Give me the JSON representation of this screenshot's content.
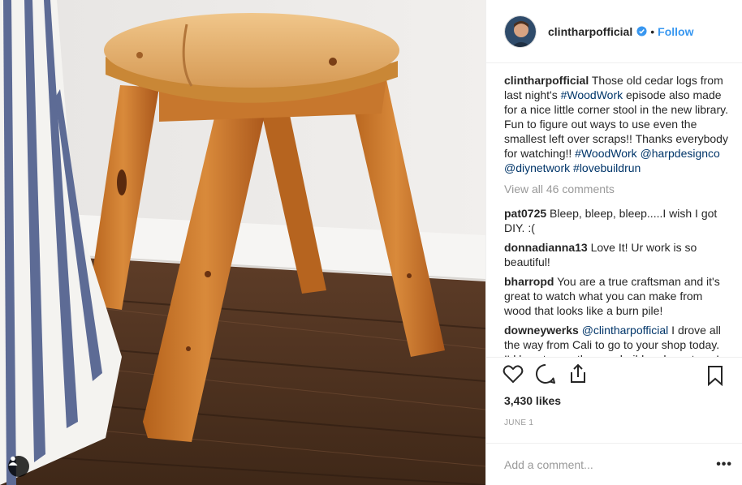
{
  "header": {
    "username": "clintharpofficial",
    "separator": "•",
    "follow_label": "Follow"
  },
  "caption": {
    "username": "clintharpofficial",
    "text_1": " Those old cedar logs from last night's ",
    "tag_1": "#WoodWork",
    "text_2": " episode also made for a nice little corner stool in the new library. Fun to figure out ways to use even the smallest left over scraps!! Thanks everybody for watching!! ",
    "tag_2": "#WoodWork",
    "text_3": " ",
    "mention_1": "@harpdesignco",
    "text_4": " ",
    "mention_2": "@diynetwork",
    "text_5": " ",
    "tag_3": "#lovebuildrun"
  },
  "view_all_comments": "View all 46 comments",
  "comments": [
    {
      "user": "pat0725",
      "text": " Bleep, bleep, bleep.....I wish I got DIY. :("
    },
    {
      "user": "donnadianna13",
      "text": " Love It! Ur work is so beautiful!"
    },
    {
      "user": "bharropd",
      "text": " You are a true craftsman and it's great to watch what you can make from wood that looks like a burn pile!"
    },
    {
      "user": "downeywerks",
      "mention": "@clintharpofficial",
      "text": " I drove all the way from Cali to go to your shop today. I'd love to see the new build and meet you!"
    }
  ],
  "likes": "3,430 likes",
  "date": "JUNE 1",
  "add_comment_placeholder": "Add a comment...",
  "more_label": "•••",
  "icons": {
    "like": "heart-icon",
    "comment": "comment-bubble-icon",
    "share": "share-icon",
    "save": "bookmark-icon",
    "verified": "verified-badge-icon",
    "user_tag": "user-tag-icon"
  },
  "colors": {
    "link": "#003569",
    "follow": "#3897f0",
    "muted": "#999999",
    "verified": "#3897f0"
  }
}
